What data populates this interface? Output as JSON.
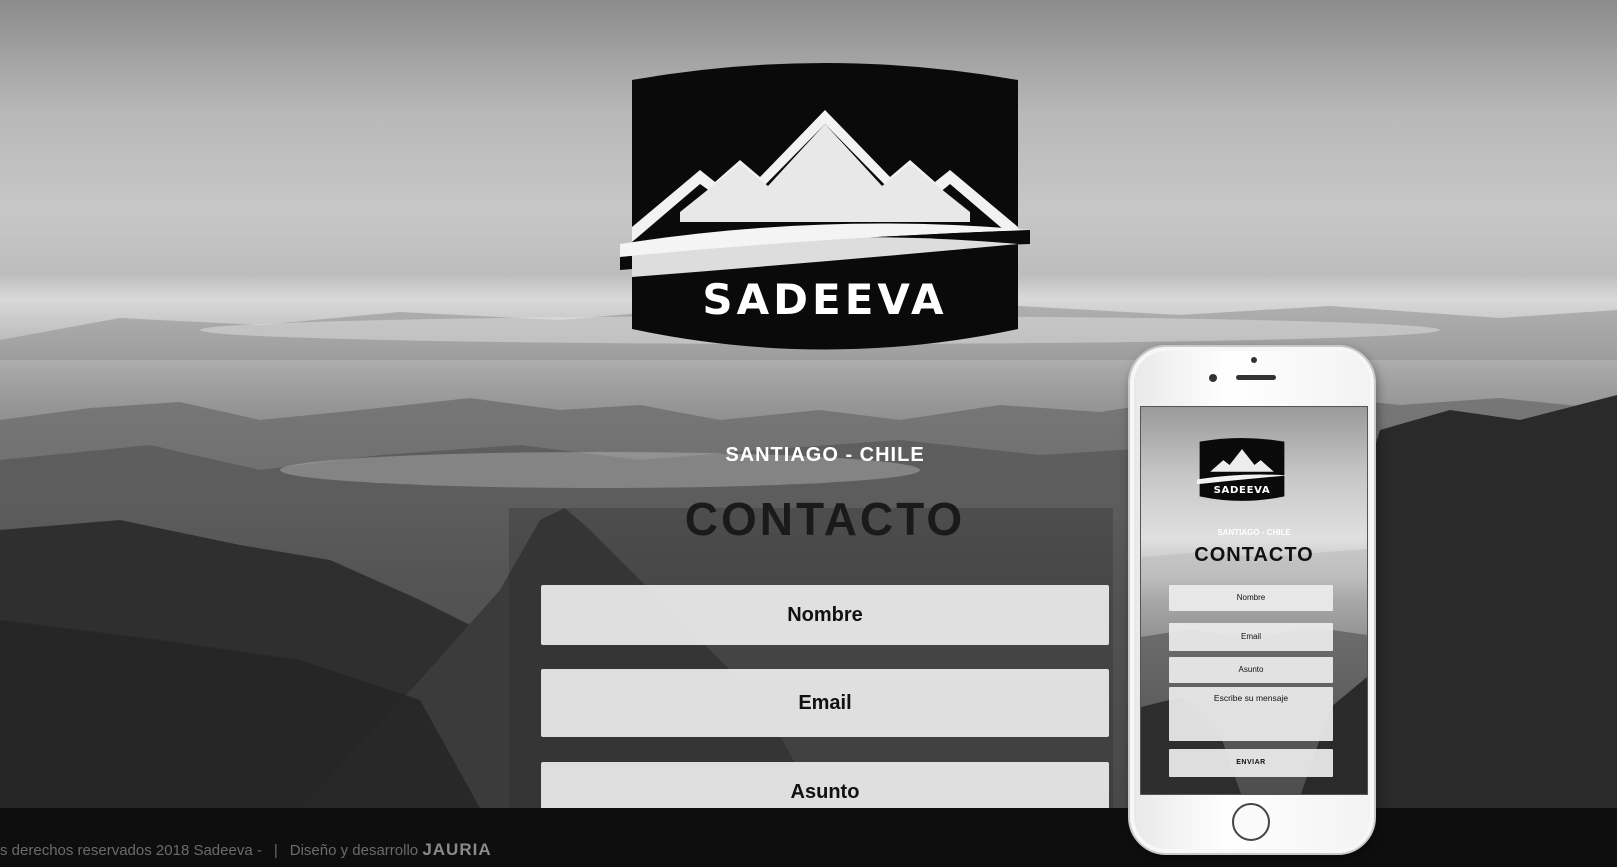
{
  "brand": {
    "name": "SADEEVA"
  },
  "hero": {
    "location": "SANTIAGO - CHILE",
    "heading": "CONTACTO"
  },
  "form": {
    "nombre_placeholder": "Nombre",
    "email_placeholder": "Email",
    "asunto_placeholder": "Asunto"
  },
  "mobile_preview": {
    "brand": "SADEEVA",
    "location": "SANTIAGO - CHILE",
    "heading": "CONTACTO",
    "nombre": "Nombre",
    "email": "Email",
    "asunto": "Asunto",
    "mensaje": "Escribe su mensaje",
    "send": "ENVIAR"
  },
  "footer": {
    "copyright": "s derechos reservados 2018 Sadeeva -",
    "separator": "|",
    "credit": "Diseño y desarrollo",
    "agency": "JAURIA"
  },
  "colors": {
    "footer_bg": "#0e0e0e",
    "logo_black": "#0a0a0a",
    "field_bg": "#ececec"
  },
  "icons": {
    "logo": "mountain-emblem-icon",
    "phone_home": "home-button-icon"
  }
}
